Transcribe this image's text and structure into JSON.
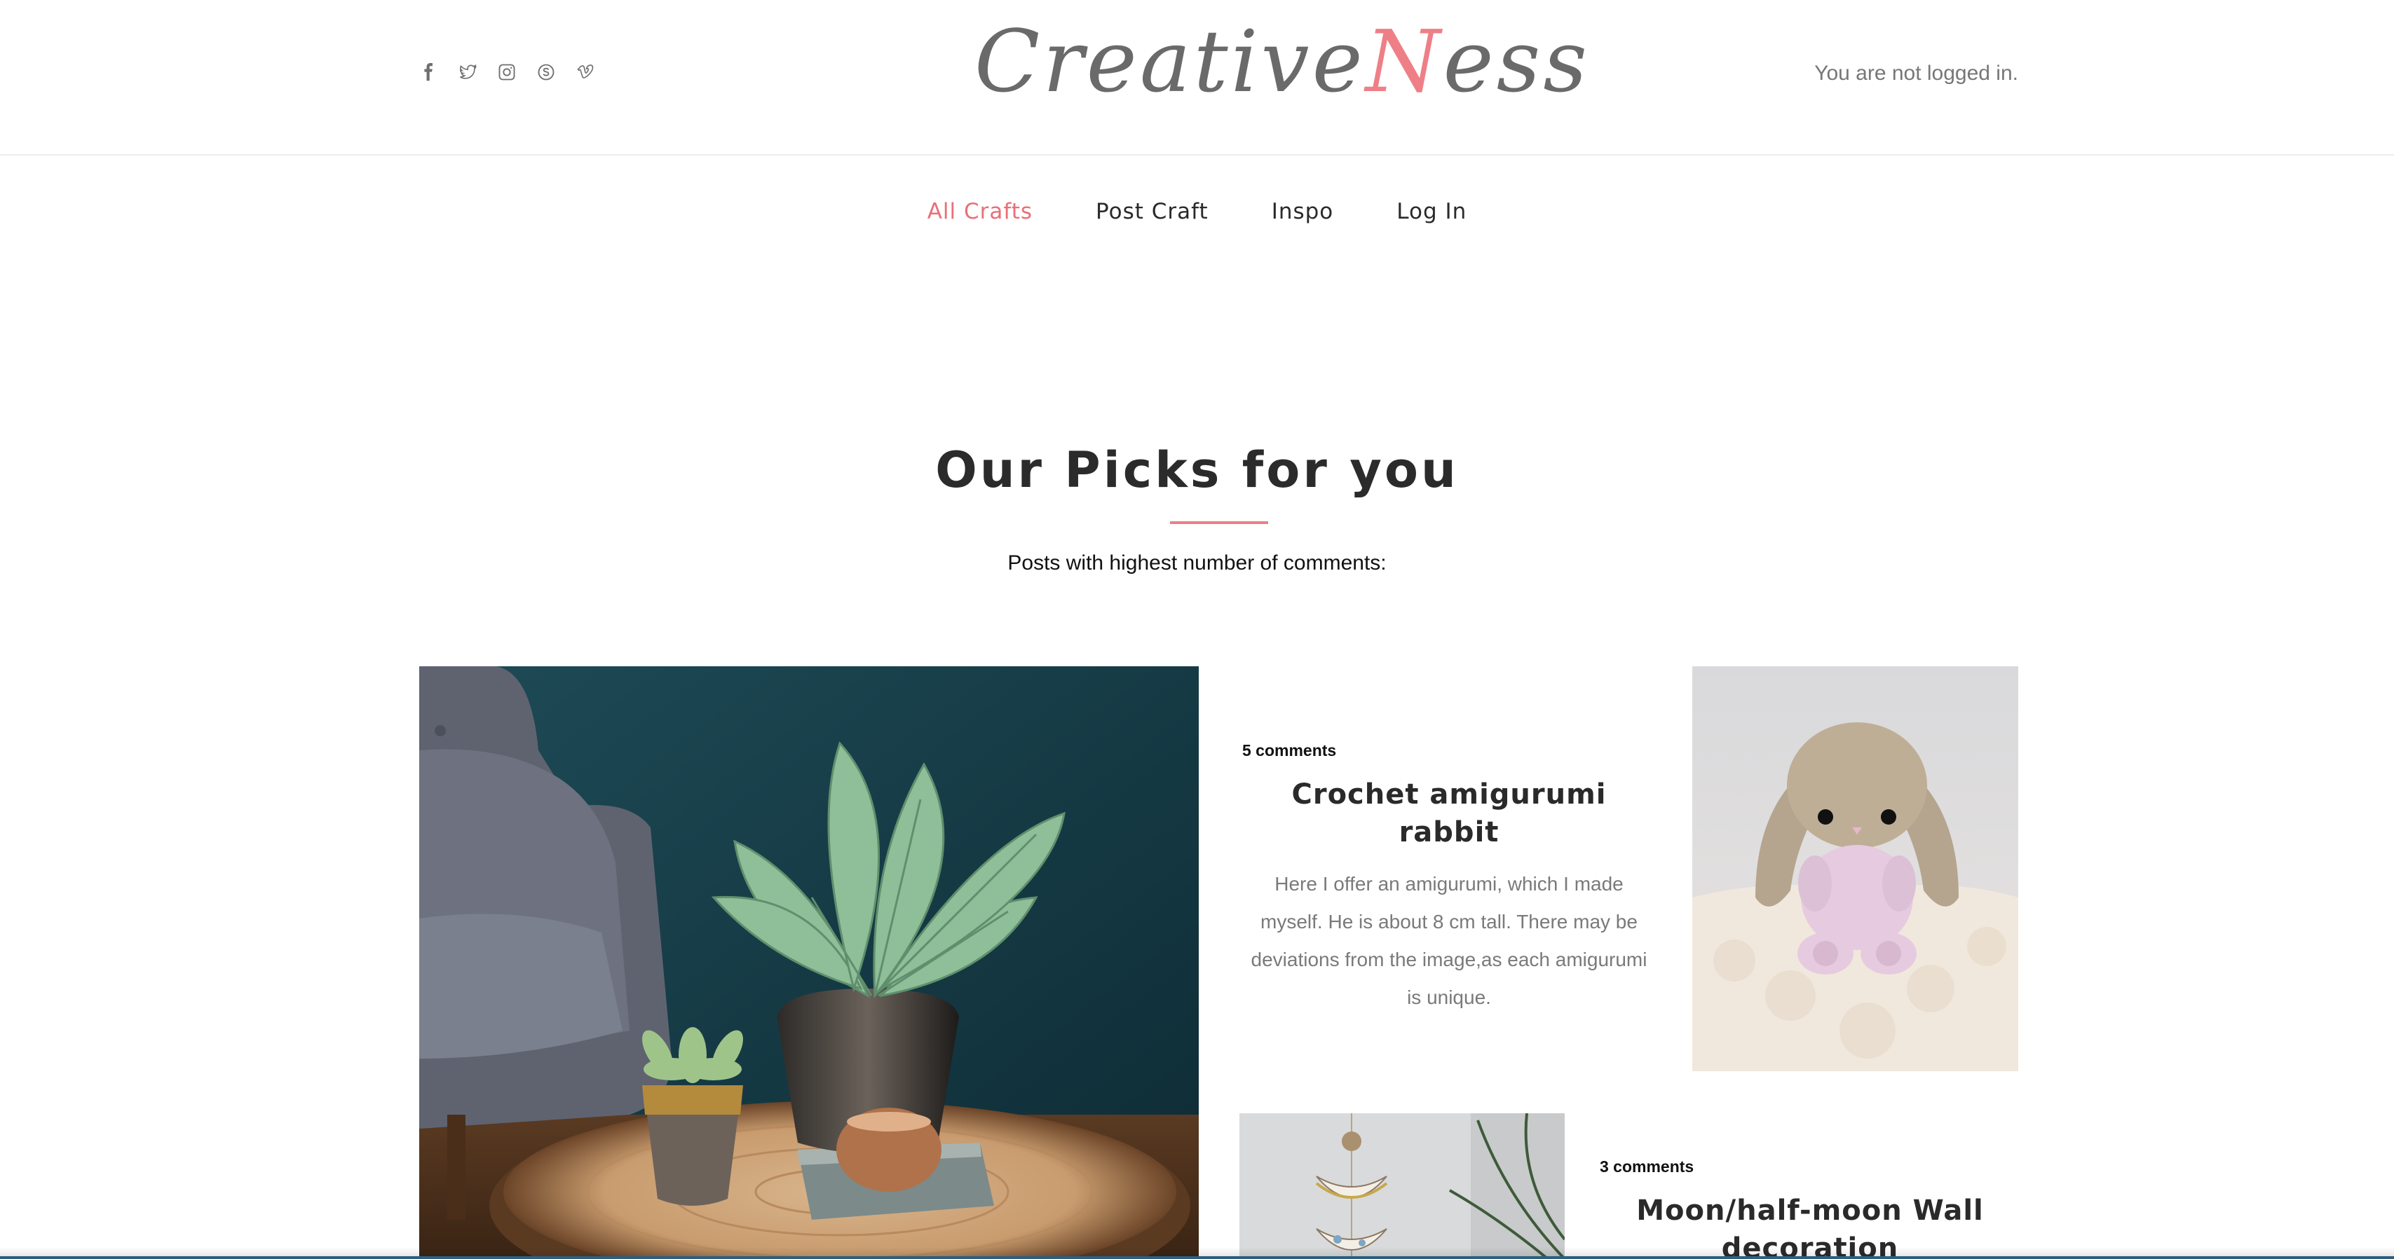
{
  "header": {
    "logo_part1": "Creative",
    "logo_accent": "N",
    "logo_part2": "ess",
    "login_status": "You are not logged in.",
    "social_icons": [
      "facebook-icon",
      "twitter-icon",
      "instagram-icon",
      "skype-icon",
      "vimeo-icon"
    ]
  },
  "nav": {
    "items": [
      {
        "label": "All Crafts",
        "active": true
      },
      {
        "label": "Post Craft",
        "active": false
      },
      {
        "label": "Inspo",
        "active": false
      },
      {
        "label": "Log In",
        "active": false
      }
    ]
  },
  "picks": {
    "title": "Our Picks for you",
    "subtitle": "Posts with highest number of comments:",
    "posts": [
      {
        "comments": "5 comments",
        "title": "Crochet amigurumi rabbit",
        "description": "Here I offer an amigurumi, which I made myself. He is about 8 cm tall. There may be deviations from the image,as each amigurumi is unique."
      },
      {
        "comments": "3 comments",
        "title": "Moon/half-moon Wall decoration"
      }
    ]
  },
  "colors": {
    "accent": "#ee7f86",
    "text": "#2a2a2a",
    "muted": "#777777"
  }
}
